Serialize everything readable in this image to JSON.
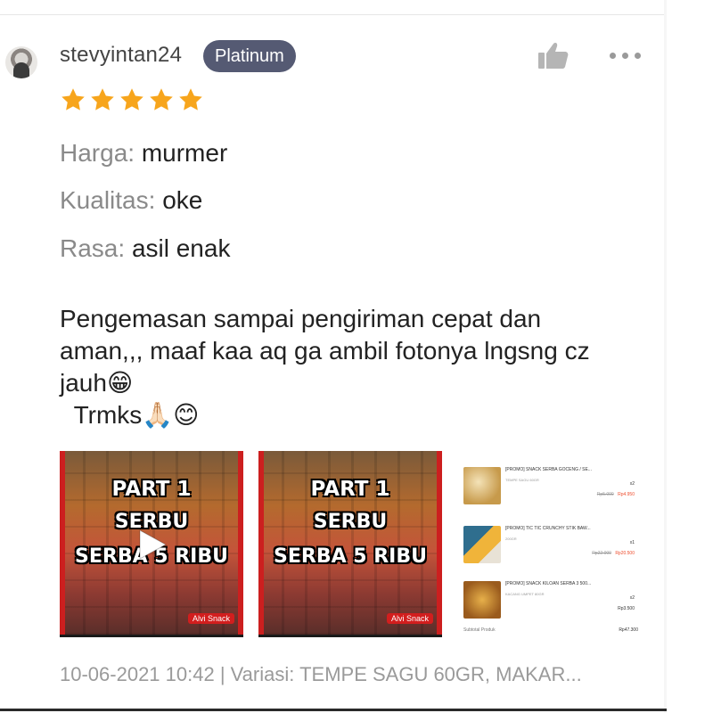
{
  "review": {
    "username": "stevyintan24",
    "badge": "Platinum",
    "rating": 5,
    "attributes": [
      {
        "key": "Harga:",
        "value": "murmer"
      },
      {
        "key": "Kualitas:",
        "value": "oke"
      },
      {
        "key": "Rasa:",
        "value": "asil enak"
      }
    ],
    "comment": "Pengemasan sampai pengiriman cepat dan\naman,,, maaf kaa aq ga ambil fotonya lngsng cz\njauh😁\n  Trmks🙏🏻😊",
    "footer": "10-06-2021 10:42 | Variasi: TEMPE SAGU 60GR, MAKAR..."
  },
  "media": {
    "video_thumb": {
      "line1": "PART 1",
      "line2": "SERBU",
      "line3": "SERBA 5 RIBU",
      "label": "Alvi Snack"
    },
    "image_thumb": {
      "line1": "PART 1",
      "line2": "SERBU",
      "line3": "SERBA 5 RIBU",
      "label": "Alvi Snack"
    },
    "receipt": {
      "items": [
        {
          "title": "[PROMO] SNACK SERBA GOCENG / SE...",
          "variant": "TEMPE SAGU 60GR",
          "qty": "x2",
          "old_price": "Rp5.000",
          "new_price": "Rp4.950"
        },
        {
          "title": "[PROMO] TIC TIC CRUNCHY STIK BAW...",
          "variant": "200GR",
          "qty": "x1",
          "old_price": "Rp22.000",
          "new_price": "Rp20.500"
        },
        {
          "title": "[PROMO] SNACK KILOAN SERBA 3 500...",
          "variant": "KACANG UMPET 80GR",
          "qty": "x2",
          "old_price": "",
          "new_price": "Rp3.500"
        }
      ],
      "subtotal_label": "Subtotal Produk",
      "subtotal_value": "Rp47.300"
    }
  },
  "colors": {
    "badge_bg": "#555a73",
    "star": "#f7a51c",
    "price_accent": "#ee4d2d"
  },
  "icons": [
    "avatar",
    "thumbs-up-icon",
    "more-options-icon",
    "star-icon",
    "play-icon"
  ]
}
